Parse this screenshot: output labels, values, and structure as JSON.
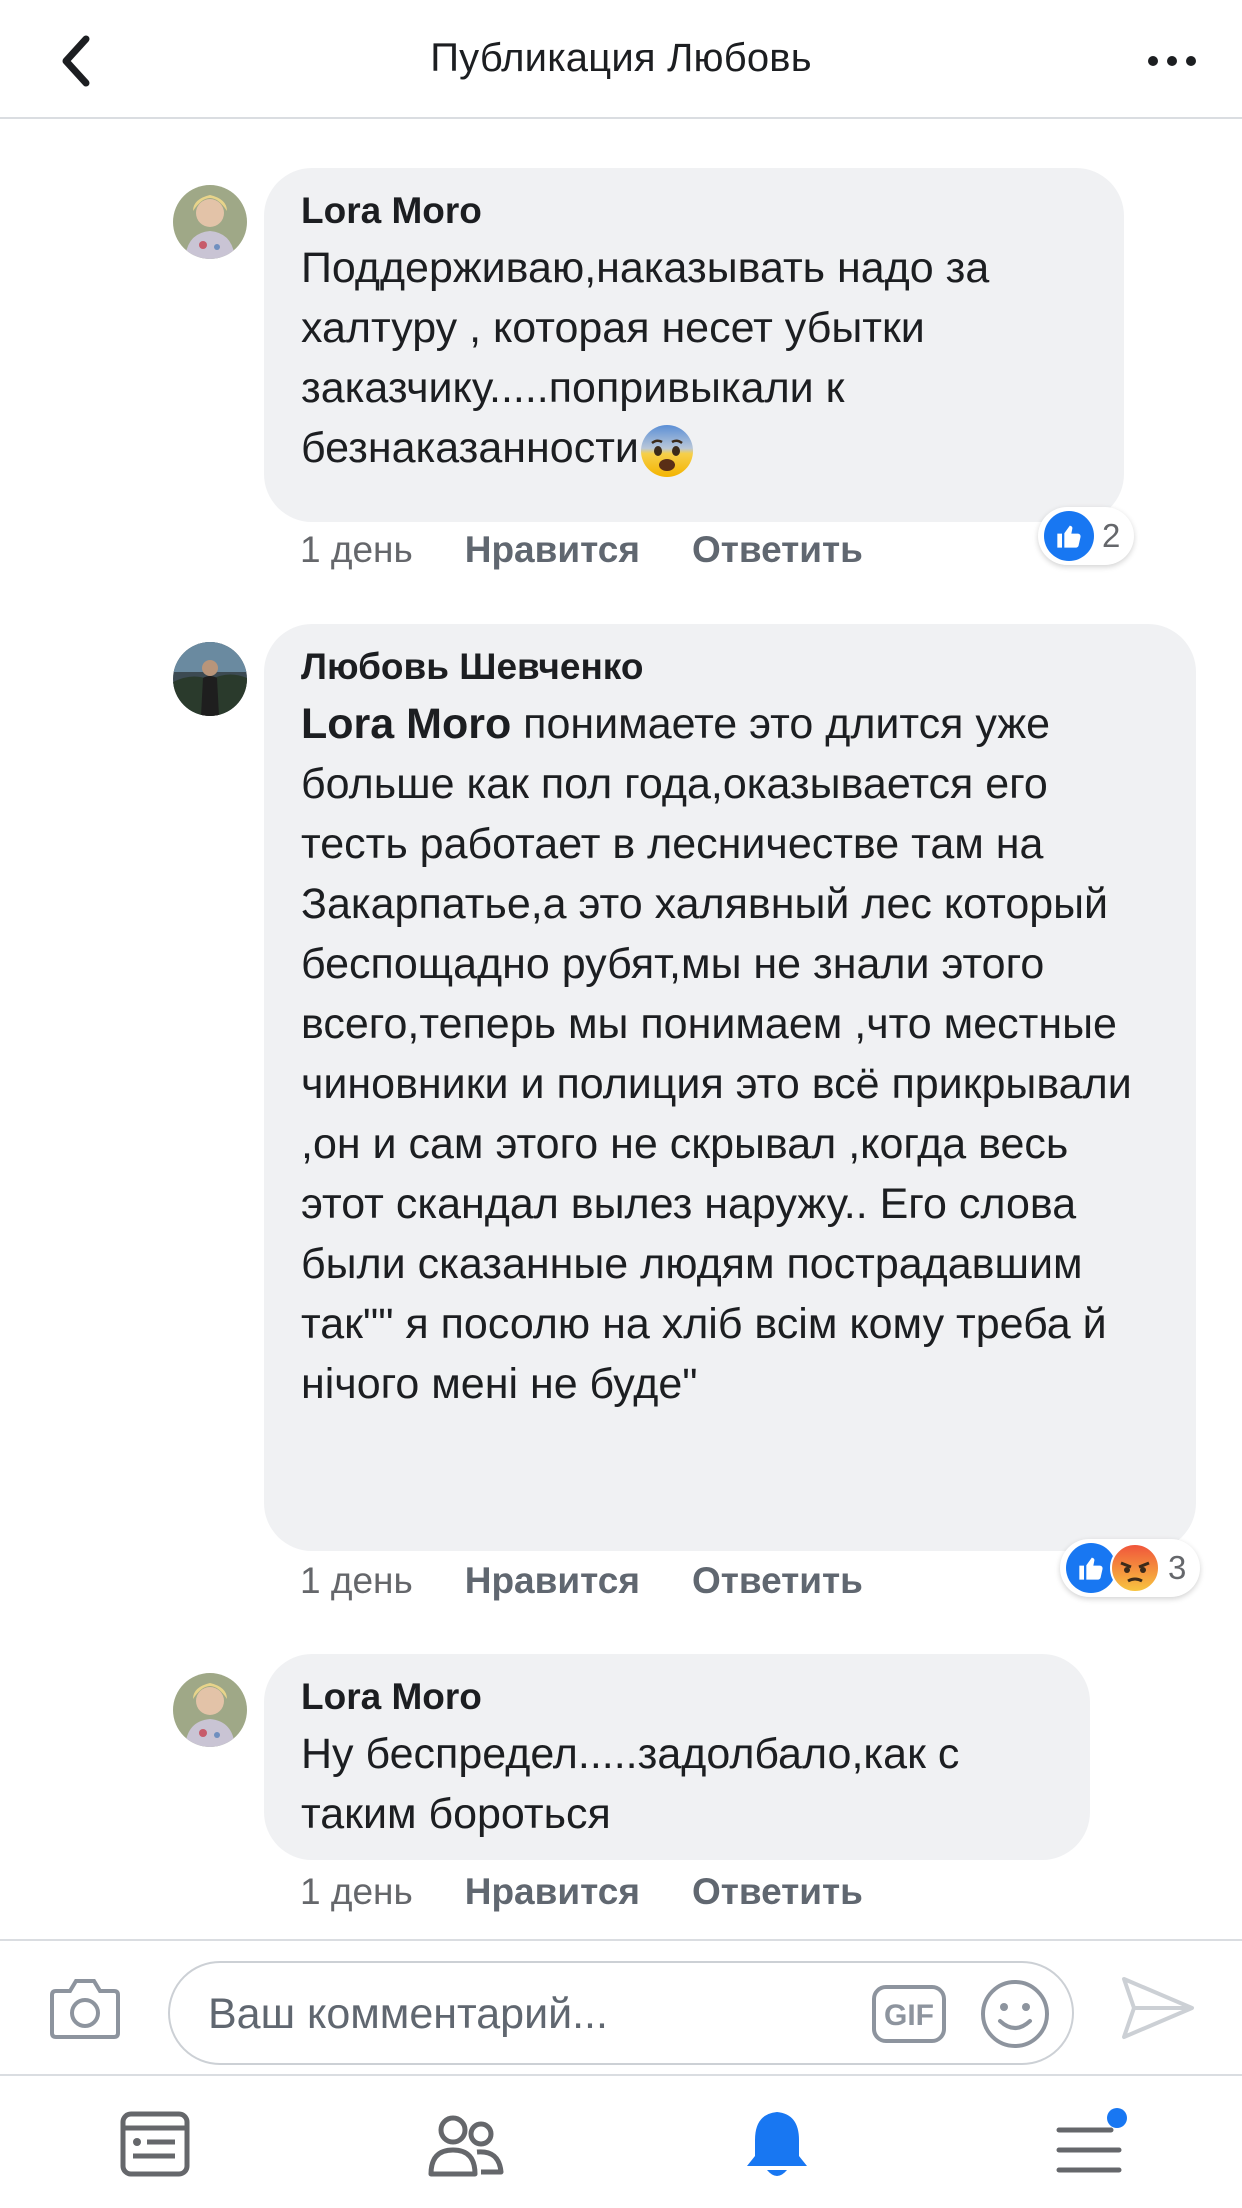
{
  "header": {
    "title": "Публикация Любовь",
    "back_icon": "chevron-left-icon",
    "more_icon": "more-dots-icon"
  },
  "comments": [
    {
      "author": "Lora Moro",
      "text": "Поддерживаю,наказывать надо за халтуру , которая несет убытки заказчику.....попривыкали к безнаказанности",
      "emoji": "anxious-face-emoji",
      "time": "1 день",
      "like_label": "Нравится",
      "reply_label": "Ответить",
      "reaction_count": "2",
      "reactions": [
        "like"
      ]
    },
    {
      "author": "Любовь Шевченко",
      "mention": "Lora Moro",
      "text": " понимаете это длится уже больше как пол года,оказывается его тесть работает в лесничестве там на Закарпатье,а это халявный лес который беспощадно рубят,мы не знали этого всего,теперь мы понимаем ,что местные  чиновники и полиция это всё прикрывали ,он и сам этого не скрывал ,когда весь этот скандал вылез наружу.. Его слова были сказанные людям пострадавшим так\"\" я посолю на хліб всім кому треба й нічого мені не буде\"",
      "time": "1 день",
      "like_label": "Нравится",
      "reply_label": "Ответить",
      "reaction_count": "3",
      "reactions": [
        "like",
        "angry"
      ]
    },
    {
      "author": "Lora Moro",
      "text": "Ну беспредел.....задолбало,как с таким бороться",
      "time": "1 день",
      "like_label": "Нравится",
      "reply_label": "Ответить"
    }
  ],
  "composer": {
    "placeholder": "Ваш комментарий...",
    "gif_label": "GIF"
  },
  "tabbar": {
    "items": [
      "news-feed-icon",
      "friends-icon",
      "notifications-bell-icon",
      "menu-icon"
    ],
    "active": "notifications-bell-icon"
  },
  "colors": {
    "accent": "#1877f2",
    "bubble": "#f0f1f3",
    "meta": "#65676b"
  }
}
